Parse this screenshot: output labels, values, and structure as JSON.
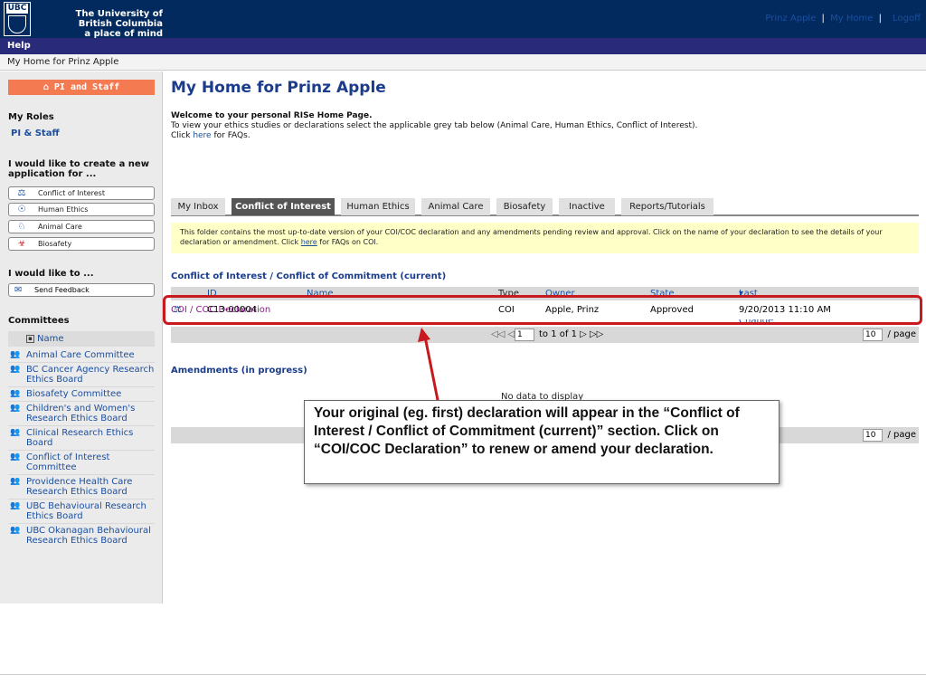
{
  "header": {
    "logo_text": "UBC",
    "university_line1": "The University of British Columbia",
    "university_line2": "a place of mind",
    "user_link": "Prinz Apple",
    "home_link": "My Home",
    "logoff_link": "Logoff",
    "separator": "|"
  },
  "help_bar": {
    "label": "Help"
  },
  "breadcrumb": {
    "text": "My Home for Prinz Apple"
  },
  "sidebar": {
    "pi_button": "PI and Staff",
    "roles_heading": "My Roles",
    "roles_link": "PI & Staff",
    "create_heading": "I would like to create a new application for ...",
    "apps": [
      {
        "label": "Conflict of Interest",
        "icon": "scales-icon"
      },
      {
        "label": "Human Ethics",
        "icon": "person-icon"
      },
      {
        "label": "Animal Care",
        "icon": "rabbit-icon"
      },
      {
        "label": "Biosafety",
        "icon": "biohazard-icon"
      }
    ],
    "like_heading": "I would like to ...",
    "feedback_button": "Send Feedback",
    "committees_heading": "Committees",
    "committees_column": "Name",
    "committees": [
      "Animal Care Committee",
      "BC Cancer Agency Research Ethics Board",
      "Biosafety Committee",
      "Children's and Women's Research Ethics Board",
      "Clinical Research Ethics Board",
      "Conflict of Interest Committee",
      "Providence Health Care Research Ethics Board",
      "UBC Behavioural Research Ethics Board",
      "UBC Okanagan Behavioural Research Ethics Board"
    ]
  },
  "main": {
    "title": "My Home for Prinz Apple",
    "welcome_bold": "Welcome to your personal RISe Home Page.",
    "welcome_line2": "To view your ethics studies or declarations select the applicable grey tab below (Animal Care, Human Ethics, Conflict of Interest).",
    "welcome_click": "Click ",
    "welcome_here": "here",
    "welcome_faq": " for FAQs.",
    "tabs": [
      "My Inbox",
      "Conflict of Interest",
      "Human Ethics",
      "Animal Care",
      "Biosafety",
      "Inactive",
      "Reports/Tutorials"
    ],
    "active_tab": "Conflict of Interest",
    "notice_text": "This folder contains the most up-to-date version of your COI/COC declaration and any amendments pending review and approval. Click on the name of your declaration to see the details of your declaration or amendment. Click ",
    "notice_here": "here",
    "notice_tail": " for FAQs on COI.",
    "current_section": "Conflict of Interest / Conflict of Commitment (current)",
    "columns": [
      "ID",
      "Name",
      "Type",
      "Owner",
      "State",
      "Last State Change"
    ],
    "rows": [
      {
        "id": "C13-00004",
        "name": "COI / COC Declaration",
        "type": "COI",
        "owner": "Apple, Prinz",
        "state": "Approved",
        "last_change": "9/20/2013 11:10 AM"
      }
    ],
    "pager_nav": "◁◁ ◁",
    "pager_page": "1",
    "pager_range": "to 1 of 1 ▷ ▷▷",
    "page_size": "10",
    "per_page": "/ page",
    "amend_section": "Amendments (in progress)",
    "no_data": "No data to display"
  },
  "callout": {
    "text": "Your original (eg. first) declaration will appear in the “Conflict of Interest / Conflict of Commitment (current)” section. Click on “COI/COC Declaration” to renew or amend your declaration."
  },
  "colors": {
    "header_bg": "#022a5e",
    "help_bg": "#2a2a7a",
    "pi_button": "#f47a52",
    "highlight": "#c8191e",
    "notice_bg": "#ffffc8"
  }
}
